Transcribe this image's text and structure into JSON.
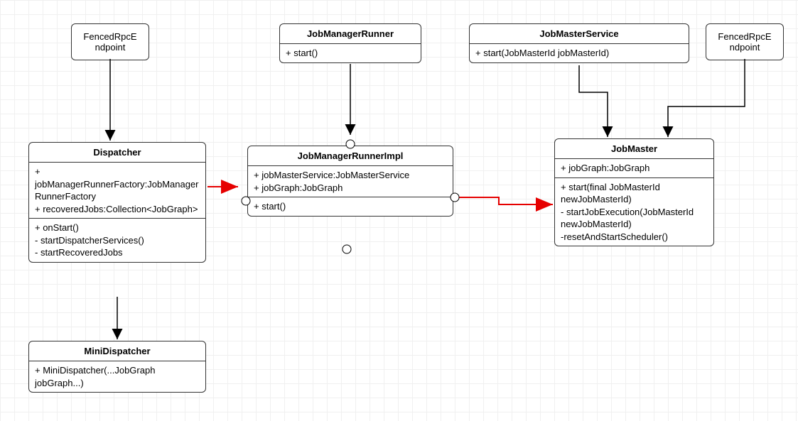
{
  "nodes": {
    "fencedRpcEndpoint1": {
      "title": "FencedRpcE\nndpoint"
    },
    "fencedRpcEndpoint2": {
      "title": "FencedRpcE\nndpoint"
    },
    "jobManagerRunner": {
      "title": "JobManagerRunner",
      "methods": "+ start()"
    },
    "jobMasterService": {
      "title": "JobMasterService",
      "methods": "+ start(JobMasterId jobMasterId)"
    },
    "dispatcher": {
      "title": "Dispatcher",
      "attrs": "+ jobManagerRunnerFactory:JobManagerRunnerFactory\n+ recoveredJobs:Collection<JobGraph>",
      "methods": "+ onStart()\n- startDispatcherServices()\n-  startRecoveredJobs"
    },
    "jobManagerRunnerImpl": {
      "title": "JobManagerRunnerImpl",
      "attrs": "+ jobMasterService:JobMasterService\n+ jobGraph:JobGraph",
      "methods": "+ start()"
    },
    "jobMaster": {
      "title": "JobMaster",
      "attrs": "+ jobGraph:JobGraph",
      "methods": "+ start(final JobMasterId newJobMasterId)\n- startJobExecution(JobMasterId newJobMasterId)\n-resetAndStartScheduler()"
    },
    "miniDispatcher": {
      "title": "MiniDispatcher",
      "methods": "+ MiniDispatcher(...JobGraph jobGraph...)"
    }
  },
  "chart_data": {
    "type": "class-diagram",
    "classes": [
      {
        "name": "FencedRpcEndpoint"
      },
      {
        "name": "JobManagerRunner",
        "methods": [
          "+ start()"
        ]
      },
      {
        "name": "JobMasterService",
        "methods": [
          "+ start(JobMasterId jobMasterId)"
        ]
      },
      {
        "name": "Dispatcher",
        "attributes": [
          "+ jobManagerRunnerFactory:JobManagerRunnerFactory",
          "+ recoveredJobs:Collection<JobGraph>"
        ],
        "methods": [
          "+ onStart()",
          "- startDispatcherServices()",
          "- startRecoveredJobs"
        ]
      },
      {
        "name": "JobManagerRunnerImpl",
        "attributes": [
          "+ jobMasterService:JobMasterService",
          "+ jobGraph:JobGraph"
        ],
        "methods": [
          "+ start()"
        ]
      },
      {
        "name": "JobMaster",
        "attributes": [
          "+ jobGraph:JobGraph"
        ],
        "methods": [
          "+ start(final JobMasterId newJobMasterId)",
          "- startJobExecution(JobMasterId newJobMasterId)",
          "- resetAndStartScheduler()"
        ]
      },
      {
        "name": "MiniDispatcher",
        "methods": [
          "+ MiniDispatcher(...JobGraph jobGraph...)"
        ]
      }
    ],
    "edges": [
      {
        "from": "FencedRpcEndpoint",
        "to": "Dispatcher",
        "type": "solid-arrow"
      },
      {
        "from": "JobManagerRunner",
        "to": "JobManagerRunnerImpl",
        "type": "realization-lollipop"
      },
      {
        "from": "JobMasterService",
        "to": "JobMaster",
        "type": "solid-arrow"
      },
      {
        "from": "FencedRpcEndpoint(2)",
        "to": "JobMaster",
        "type": "solid-arrow"
      },
      {
        "from": "Dispatcher",
        "to": "MiniDispatcher",
        "type": "solid-arrow"
      },
      {
        "from": "Dispatcher",
        "to": "JobManagerRunnerImpl",
        "type": "dependency-red-lollipop"
      },
      {
        "from": "JobManagerRunnerImpl",
        "to": "JobMaster",
        "type": "dependency-red"
      },
      {
        "from": "JobManagerRunnerImpl(bottom)",
        "to": "JobManagerRunnerImpl",
        "type": "self-lollipop"
      }
    ]
  }
}
